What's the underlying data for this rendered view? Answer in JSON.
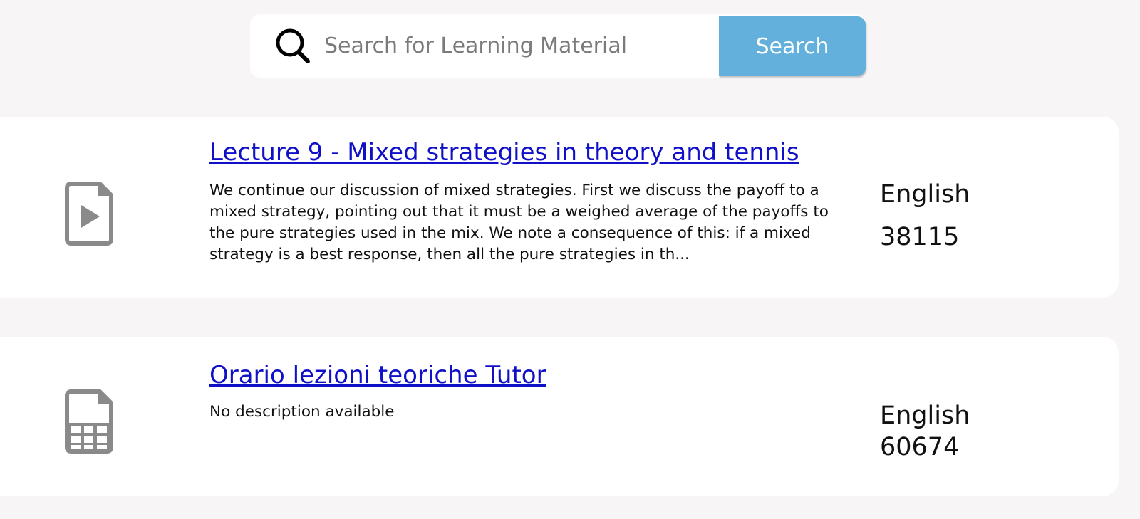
{
  "search": {
    "placeholder": "Search for Learning Material",
    "button_label": "Search",
    "accent_color": "#62b0db"
  },
  "results": [
    {
      "icon": "video-file-icon",
      "title": "Lecture 9 - Mixed strategies in theory and tennis",
      "description": "We continue our discussion of mixed strategies. First we discuss the payoff to a mixed strategy, pointing out that it must be a weighed average of the payoffs to the pure strategies used in the mix. We note a consequence of this: if a mixed strategy is a best response, then all the pure strategies in th...",
      "language": "English",
      "count": "38115"
    },
    {
      "icon": "spreadsheet-file-icon",
      "title": "Orario lezioni teoriche Tutor",
      "description": "No description available",
      "language": "English",
      "count": "60674"
    }
  ],
  "colors": {
    "background": "#f7f5f6",
    "link": "#1010c8",
    "icon_gray": "#8a8a8a"
  }
}
